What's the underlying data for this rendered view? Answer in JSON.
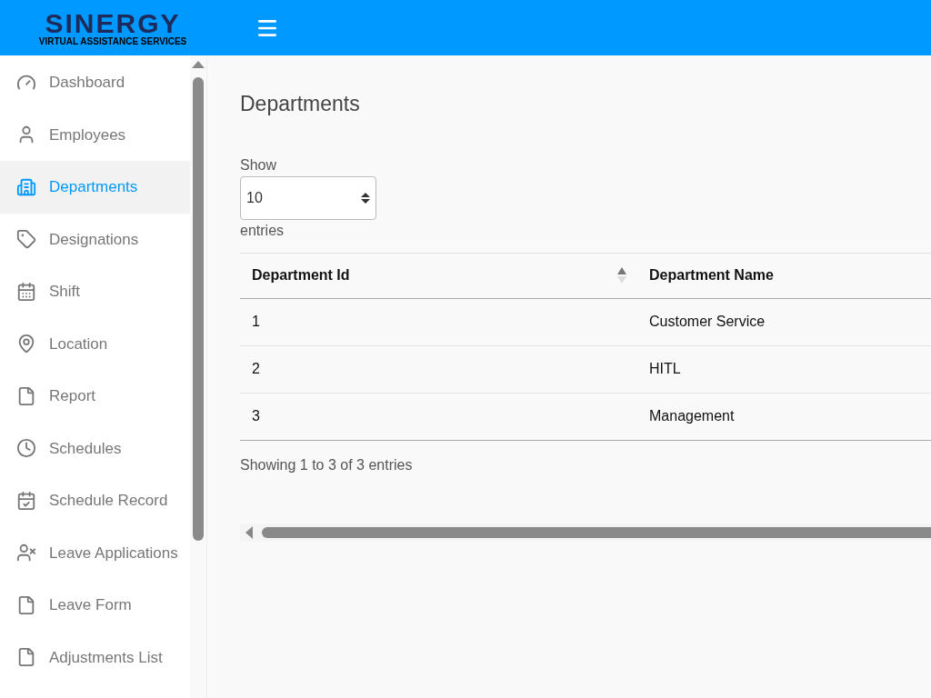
{
  "header": {
    "logo_title": "SINERGY",
    "logo_subtitle": "VIRTUAL ASSISTANCE SERVICES"
  },
  "sidebar": {
    "items": [
      {
        "label": "Dashboard",
        "selected": false
      },
      {
        "label": "Employees",
        "selected": false
      },
      {
        "label": "Departments",
        "selected": true
      },
      {
        "label": "Designations",
        "selected": false
      },
      {
        "label": "Shift",
        "selected": false
      },
      {
        "label": "Location",
        "selected": false
      },
      {
        "label": "Report",
        "selected": false
      },
      {
        "label": "Schedules",
        "selected": false
      },
      {
        "label": "Schedule Record",
        "selected": false
      },
      {
        "label": "Leave Applications",
        "selected": false
      },
      {
        "label": "Leave Form",
        "selected": false
      },
      {
        "label": "Adjustments List",
        "selected": false
      }
    ]
  },
  "page": {
    "title": "Departments",
    "show_label": "Show",
    "page_size": "10",
    "entries_label": "entries",
    "table": {
      "columns": [
        {
          "label": "Department Id",
          "sorted": true
        },
        {
          "label": "Department Name",
          "sorted": false
        }
      ],
      "rows": [
        [
          "1",
          "Customer Service"
        ],
        [
          "2",
          "HITL"
        ],
        [
          "3",
          "Management"
        ]
      ]
    },
    "info": "Showing 1 to 3 of 3 entries"
  }
}
